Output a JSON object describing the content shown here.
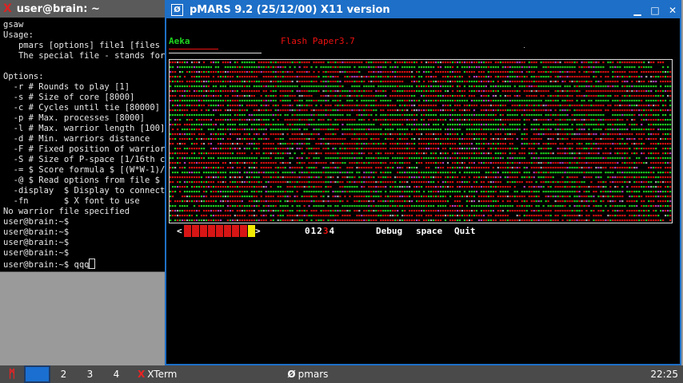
{
  "xterm": {
    "title": "user@brain: ~",
    "lines": [
      "gsaw",
      "Usage:",
      "   pmars [options] file1 [files ..",
      "   The special file - stands for s",
      "",
      "Options:",
      "  -r # Rounds to play [1]",
      "  -s # Size of core [8000]",
      "  -c # Cycles until tie [80000]",
      "  -p # Max. processes [8000]",
      "  -l # Max. warrior length [100]",
      "  -d # Min. warriors distance",
      "  -F # Fixed position of warrior #",
      "  -S # Size of P-space [1/16th co",
      "  -= $ Score formula $ [(W*W-1)/S]",
      "  -@ $ Read options from file $",
      "  -display  $ Display to connect t",
      "  -fn       $ X font to use",
      "No warrior file specified",
      "user@brain:~$",
      "user@brain:~$",
      "user@brain:~$",
      "user@brain:~$",
      "user@brain:~$ qqq"
    ]
  },
  "pmars": {
    "title": "pMARS 9.2 (25/12/00) X11 version",
    "warrior1": "Aeka",
    "warrior2": "Flash Paper3.7",
    "left_arrow": "<",
    "right_arrow": ">",
    "display_modes": [
      "0",
      "1",
      "2",
      "3",
      "4"
    ],
    "active_mode": "3",
    "debug_label": "Debug",
    "space_label": "space",
    "quit_label": "Quit",
    "speed_segments": 9,
    "speed_level": 9,
    "colors": {
      "warrior1": "#1fd41f",
      "warrior2": "#e11111",
      "window_accent": "#1e6fc7",
      "speed_knob": "#f2ea00"
    }
  },
  "taskbar": {
    "workspaces": [
      "1",
      "2",
      "3",
      "4"
    ],
    "active_workspace": "1",
    "tasks": [
      {
        "icon": "xterm-icon",
        "label": "XTerm"
      },
      {
        "icon": "pmars-icon",
        "label": "pmars"
      }
    ],
    "clock": "22:25"
  }
}
